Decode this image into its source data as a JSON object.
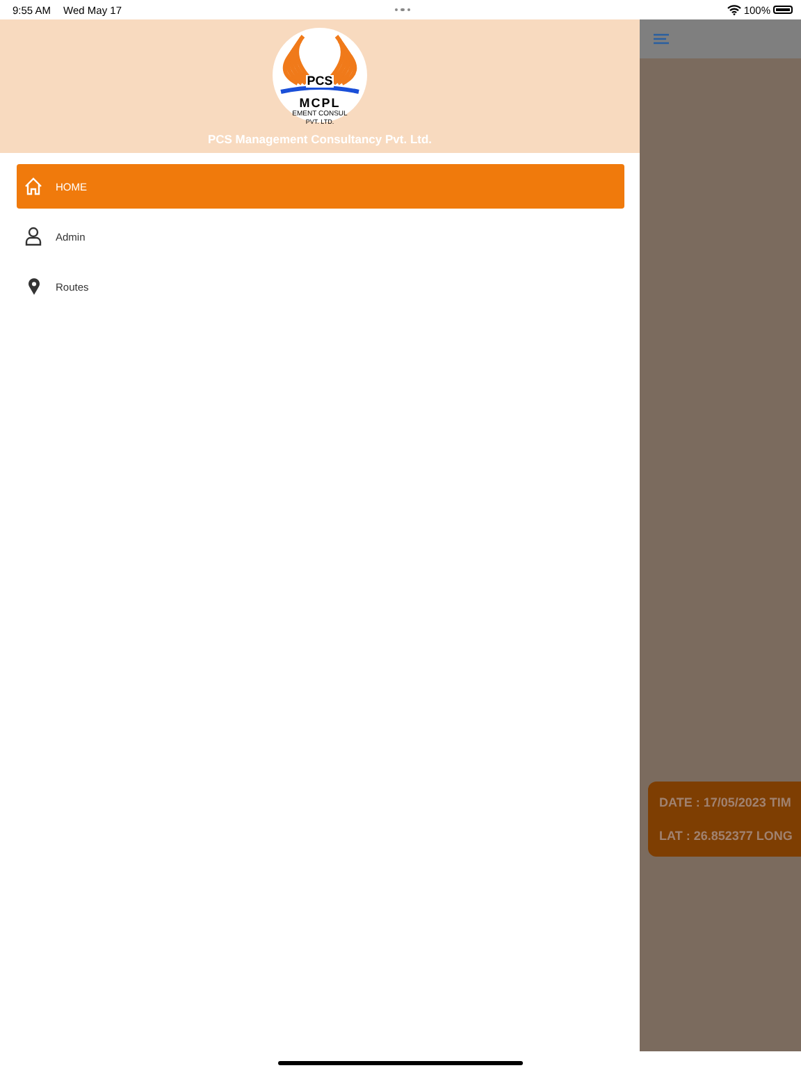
{
  "status_bar": {
    "time": "9:55 AM",
    "date": "Wed May 17",
    "battery": "100%"
  },
  "drawer": {
    "logo": {
      "top": "PCS",
      "middle": "MCPL",
      "lower": "EMENT CONSUL",
      "bottom": "PVT. LTD."
    },
    "company": "PCS Management Consultancy Pvt. Ltd.",
    "items": [
      {
        "label": "HOME",
        "selected": true
      },
      {
        "label": "Admin",
        "selected": false
      },
      {
        "label": "Routes",
        "selected": false
      }
    ]
  },
  "background_card": {
    "lines": [
      "DATE : 17/05/2023 TIM",
      "LAT : 26.852377 LONG"
    ]
  }
}
